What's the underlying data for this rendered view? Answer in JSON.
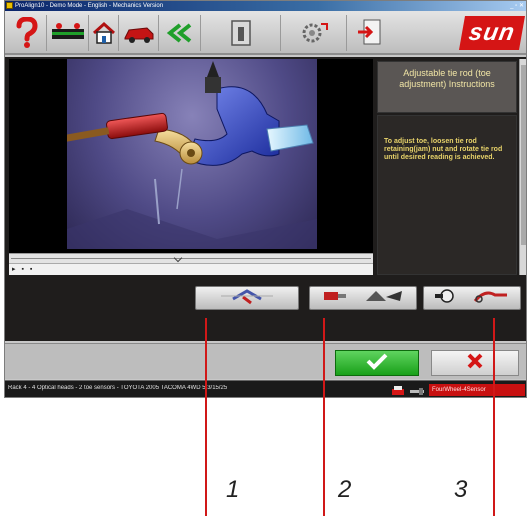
{
  "window": {
    "title": "ProAlign10 - Demo Mode - English - Mechanics Version"
  },
  "toolbar": {
    "buttons": [
      {
        "icon": "question-icon"
      },
      {
        "icon": "vehicle-specs-icon"
      },
      {
        "icon": "home-icon"
      },
      {
        "icon": "car-icon"
      },
      {
        "icon": "back-arrows-icon"
      },
      {
        "icon": "info-panel-icon"
      },
      {
        "icon": "settings-icon"
      },
      {
        "icon": "document-export-icon"
      }
    ],
    "brand": "sun"
  },
  "instructions": {
    "title": "Adjustable tie rod (toe adjustment) Instructions",
    "body": "To adjust toe, loosen tie rod retaining(jam) nut and rotate tie rod until desired reading is achieved."
  },
  "video": {
    "controls": "▸ ▪ ▪"
  },
  "tools": [
    {
      "name": "adjustment-tool-1-button"
    },
    {
      "name": "adjustment-tool-2-button"
    },
    {
      "name": "adjustment-tool-3-button"
    }
  ],
  "status": {
    "text": "Rack 4 - 4 Optical heads - 2 toe sensors - TOYOTA 2005 TACOMA 4WD 5/3/15/25",
    "alert": "FourWheel-4Sensor"
  },
  "callouts": [
    "1",
    "2",
    "3"
  ],
  "colors": {
    "accent": "#d51515",
    "ok": "#19a019",
    "instruction_text": "#e8d36a"
  }
}
